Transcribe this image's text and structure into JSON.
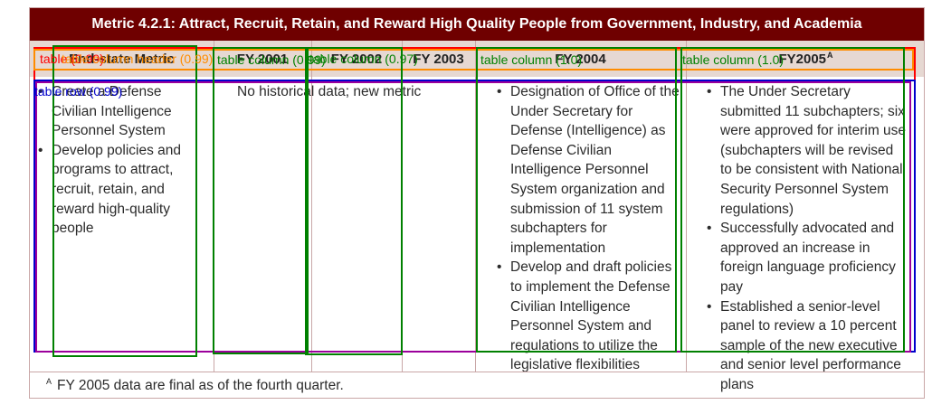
{
  "table": {
    "title": "Metric 4.2.1:  Attract, Recruit, Retain, and Reward High Quality People from Government, Industry, and Academia",
    "headers": {
      "metric": "End-state Metric",
      "fy2001": "FY 2001",
      "fy2002": "FY 2002",
      "fy2003": "FY 2003",
      "fy2004": "FY 2004",
      "fy2005": "FY2005",
      "fy2005_sup": "A"
    },
    "metric_items": [
      "Create a Defense Civilian Intelligence Personnel System",
      "Develop policies and programs to attract, recruit, retain, and reward high-quality people"
    ],
    "fy2001_text": "No historical data; new metric",
    "fy2004_items": [
      "Designation of Office of the Under Secretary for Defense (Intelligence) as Defense Civilian Intelligence Personnel System organization and submission of 11 system subchapters for implementation",
      "Develop and draft policies to implement the Defense Civilian Intelligence Personnel System and regulations to utilize the legislative flexibilities"
    ],
    "fy2005_items": [
      "The Under Secretary submitted 11 subchapters; six were approved for interim use (subchapters will be revised to be consistent with National Security Personnel System regulations)",
      "Successfully advocated and approved an increase in foreign language proficiency pay",
      "Established a senior-level panel to review a 10 percent sample of the new executive and senior level performance plans"
    ],
    "footnote_mark": "A",
    "footnote": "FY 2005 data are final as of the fourth quarter."
  },
  "annotations": {
    "table_label": "table (0.99)",
    "header_label": "table column header (0.99)",
    "col_label_1": "table column (0.99)",
    "col_label_2": "table column (0.97)",
    "col_label_3": "table column (1.0)",
    "col_label_4": "table column (1.0)",
    "row_label": "table row (0.99)",
    "colors": {
      "table": "#ff0000",
      "header": "#ff8c00",
      "column": "#008000",
      "row": "#0000cc",
      "purple": "#9b009b"
    }
  }
}
